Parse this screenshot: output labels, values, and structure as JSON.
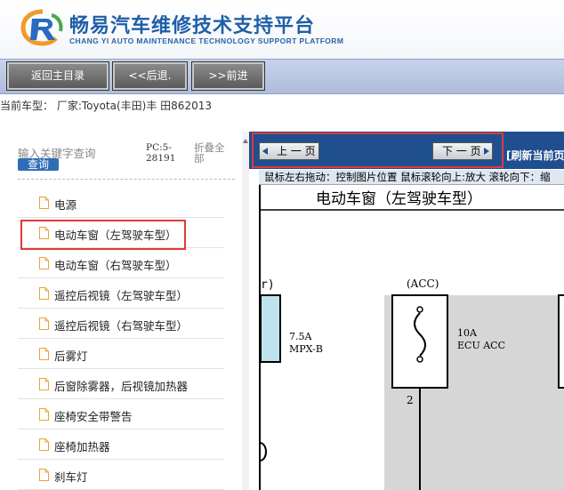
{
  "header": {
    "title": "畅易汽车维修技术支持平台",
    "subtitle": "CHANG YI AUTO MAINTENANCE TECHNOLOGY SUPPORT PLATFORM"
  },
  "toolbar": {
    "home_label": "返回主目录",
    "back_label": "<<后退.",
    "forward_label": ">>前进"
  },
  "vehicle": {
    "line": "当前车型：  厂家:Toyota(丰田)丰 田862013"
  },
  "sidebar": {
    "search_label": "输入关键字查询",
    "search_button": "查询",
    "pc_info": "PC:5-28191",
    "collapse_all": "折叠全部",
    "items": [
      {
        "label": "电源"
      },
      {
        "label": "电动车窗（左驾驶车型）"
      },
      {
        "label": "电动车窗（右驾驶车型）"
      },
      {
        "label": "遥控后视镜（左驾驶车型）"
      },
      {
        "label": "遥控后视镜（右驾驶车型）"
      },
      {
        "label": "后雾灯"
      },
      {
        "label": "后窗除雾器，后视镜加热器"
      },
      {
        "label": "座椅安全带警告"
      },
      {
        "label": "座椅加热器"
      },
      {
        "label": "刹车灯"
      }
    ],
    "selected_index": 1
  },
  "viewer": {
    "prev_page": "上 一 页",
    "next_page": "下 一 页",
    "refresh": "[刷新当前页",
    "hint": "鼠标左右拖动：控制图片位置 鼠标滚轮向上:放大  滚轮向下：缩",
    "diagram": {
      "title": "电动车窗（左驾驶车型）",
      "left_paren": "r)",
      "acc_label": "(ACC)",
      "fuse_left_rating": "7.5A",
      "fuse_left_name": "MPX-B",
      "fuse_right_rating": "10A",
      "fuse_right_name": "ECU ACC",
      "pin": "2"
    }
  },
  "colors": {
    "brand_blue": "#1f5fa8",
    "pager_blue": "#1f4f8f",
    "highlight_red": "#e03a3a",
    "fuse_cyan": "#bfe3ee",
    "fuse_gray": "#d6d6d6"
  }
}
